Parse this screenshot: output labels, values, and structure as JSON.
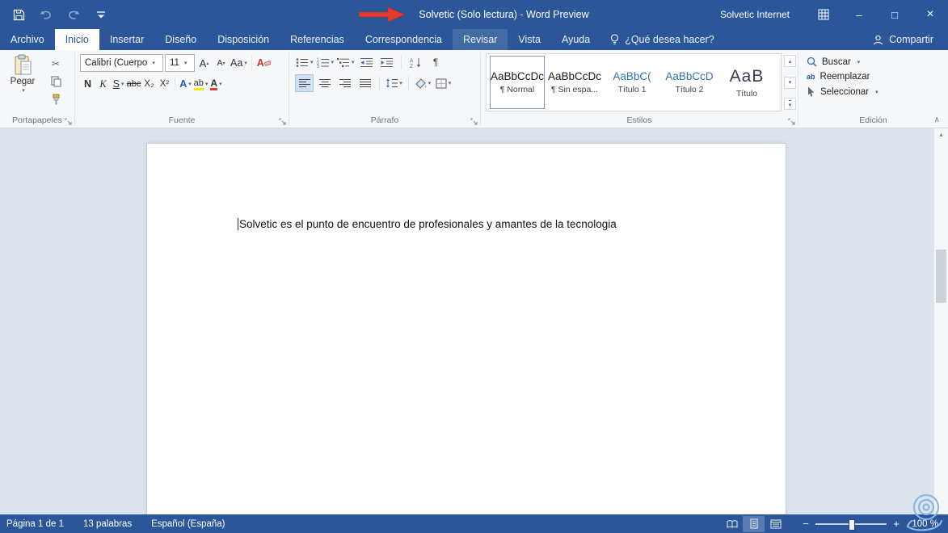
{
  "icons": {
    "dd": "▾",
    "up": "▴",
    "collapse": "∧",
    "scroll_up": "▲",
    "cut": "✂",
    "pilcrow": "¶",
    "minus": "−",
    "plus": "+"
  },
  "titlebar": {
    "title": "Solvetic (Solo lectura) - Word Preview",
    "user": "Solvetic Internet",
    "minimize": "–",
    "maximize": "□",
    "close": "×"
  },
  "tabs": [
    {
      "label": "Archivo"
    },
    {
      "label": "Inicio"
    },
    {
      "label": "Insertar"
    },
    {
      "label": "Diseño"
    },
    {
      "label": "Disposición"
    },
    {
      "label": "Referencias"
    },
    {
      "label": "Correspondencia"
    },
    {
      "label": "Revisar"
    },
    {
      "label": "Vista"
    },
    {
      "label": "Ayuda"
    }
  ],
  "tellme": "¿Qué desea hacer?",
  "share": "Compartir",
  "ribbon": {
    "clipboard": {
      "group_label": "Portapapeles",
      "paste": "Pegar"
    },
    "font": {
      "group_label": "Fuente",
      "family": "Calibri (Cuerpo",
      "size": "11",
      "grow": "A",
      "shrink": "A",
      "change_case": "Aa",
      "clear": "A",
      "bold": "N",
      "italic": "K",
      "underline": "S",
      "strike": "abc",
      "subscript": "X₂",
      "superscript": "X²",
      "effects": "A",
      "highlight": "ab",
      "color": "A"
    },
    "paragraph": {
      "group_label": "Párrafo"
    },
    "styles": {
      "group_label": "Estilos",
      "items": [
        {
          "preview": "AaBbCcDc",
          "name": "¶ Normal"
        },
        {
          "preview": "AaBbCcDc",
          "name": "¶ Sin espa..."
        },
        {
          "preview": "AaBbC(",
          "name": "Título 1"
        },
        {
          "preview": "AaBbCcD",
          "name": "Título 2"
        },
        {
          "preview": "AaB",
          "name": "Título"
        }
      ]
    },
    "editing": {
      "group_label": "Edición",
      "find": "Buscar",
      "replace": "Reemplazar",
      "replace_icon": "ab",
      "select": "Seleccionar"
    }
  },
  "document": {
    "text": "Solvetic es el punto de encuentro de profesionales y amantes de la tecnologia"
  },
  "statusbar": {
    "page": "Página 1 de 1",
    "words": "13 palabras",
    "language": "Español (España)",
    "zoom_level": "100 %"
  },
  "colors": {
    "chrome_blue": "#2b579a",
    "arrow_red": "#e23a2e",
    "heading_blue": "#2e74b5",
    "highlight_yellow": "#ffe400",
    "font_color_red": "#e03c31"
  }
}
